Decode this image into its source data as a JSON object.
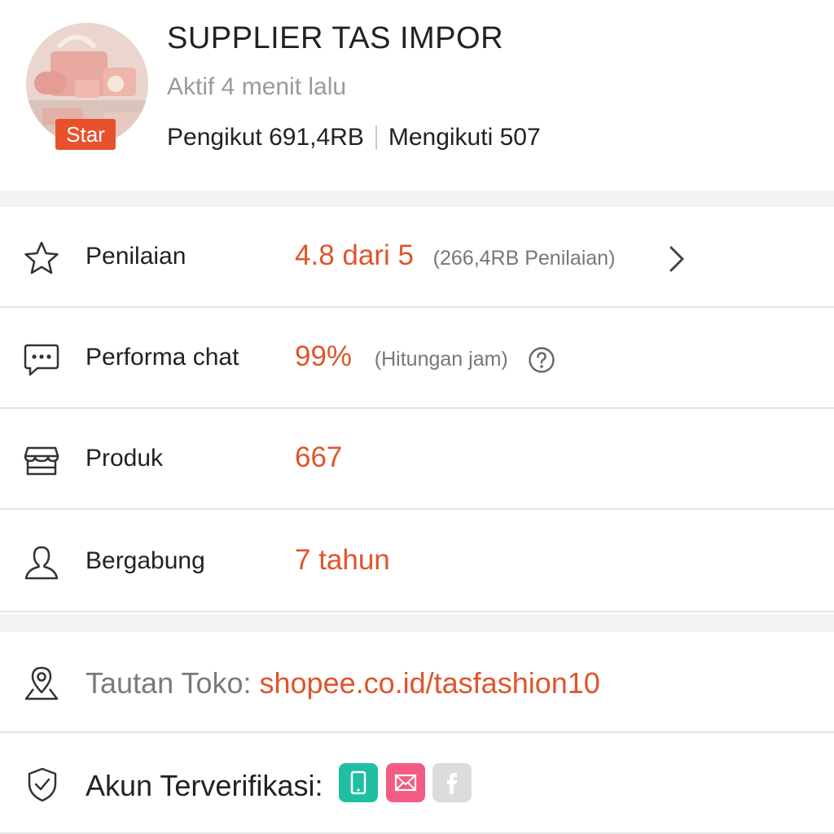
{
  "shop": {
    "name": "SUPPLIER TAS IMPOR",
    "status": "Aktif 4 menit lalu",
    "badge": "Star",
    "followers_label": "Pengikut 691,4RB",
    "following_label": "Mengikuti 507"
  },
  "stats": {
    "rating": {
      "label": "Penilaian",
      "value": "4.8 dari 5",
      "note": "(266,4RB Penilaian)",
      "icon": "star-icon"
    },
    "chat": {
      "label": "Performa chat",
      "value": "99%",
      "note": "(Hitungan jam)",
      "icon": "chat-icon"
    },
    "products": {
      "label": "Produk",
      "value": "667",
      "icon": "store-icon"
    },
    "joined": {
      "label": "Bergabung",
      "value": "7 tahun",
      "icon": "user-icon"
    }
  },
  "link": {
    "label": "Tautan Toko: ",
    "url": "shopee.co.id/tasfashion10",
    "icon": "location-pin-icon"
  },
  "verified": {
    "label": "Akun Terverifikasi:",
    "icon": "shield-check-icon",
    "badges": [
      {
        "icon": "phone-icon",
        "color": "#1fbfa3",
        "active": true
      },
      {
        "icon": "mail-icon",
        "color": "#f25b84",
        "active": true
      },
      {
        "icon": "facebook-icon",
        "color": "#dcdcdc",
        "active": false
      }
    ]
  },
  "colors": {
    "accent": "#e0542a",
    "badge": "#e8512b"
  }
}
